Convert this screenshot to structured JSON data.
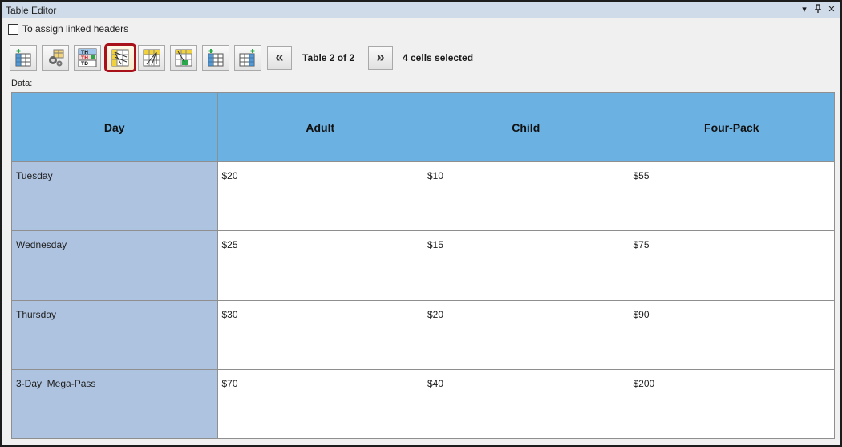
{
  "window": {
    "title": "Table Editor",
    "icons": [
      "dropdown-arrow-icon",
      "pin-icon",
      "close-icon"
    ]
  },
  "option": {
    "checked": false,
    "label": "To assign linked headers"
  },
  "toolbar": {
    "buttons": [
      {
        "name": "insert-table-icon"
      },
      {
        "name": "table-settings-icon"
      },
      {
        "name": "th-td-toggle-icon",
        "text": [
          "TH",
          "TH",
          "TD"
        ]
      },
      {
        "name": "row-headers-icon",
        "active": true
      },
      {
        "name": "column-headers-icon"
      },
      {
        "name": "cell-headers-icon"
      },
      {
        "name": "add-row-icon"
      },
      {
        "name": "add-column-icon"
      }
    ],
    "prev_label": "«",
    "table_status": "Table 2 of 2",
    "next_label": "»",
    "selection_status": "4 cells selected",
    "colors": {
      "active_border": "#a8101a",
      "header_bg": "#6bb1e1",
      "row_header_bg": "#aec3df"
    }
  },
  "data_label": "Data:",
  "table": {
    "headers": [
      "Day",
      "Adult",
      "Child",
      "Four-Pack"
    ],
    "rows": [
      [
        "Tuesday",
        "$20",
        "$10",
        "$55"
      ],
      [
        "Wednesday",
        "$25",
        "$15",
        "$75"
      ],
      [
        "Thursday",
        "$30",
        "$20",
        "$90"
      ],
      [
        "3-Day  Mega-Pass",
        "$70",
        "$40",
        "$200"
      ]
    ]
  }
}
